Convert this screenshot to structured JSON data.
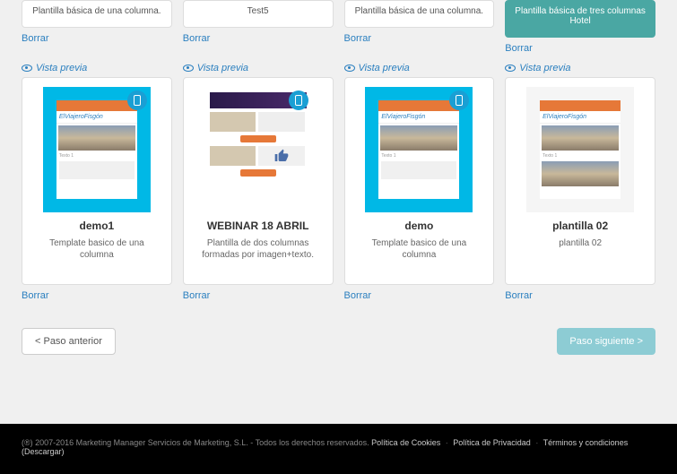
{
  "labels": {
    "delete": "Borrar",
    "preview": "Vista previa",
    "prev_button": "< Paso anterior",
    "next_button": "Paso siguiente >"
  },
  "top_row": [
    {
      "desc": "Plantilla básica de una columna.",
      "teal": false
    },
    {
      "desc": "Test5",
      "teal": false
    },
    {
      "desc": "Plantilla básica de una columna.",
      "teal": false
    },
    {
      "desc": "Plantilla básica de tres columnas Hotel",
      "teal": true
    }
  ],
  "templates": [
    {
      "title": "demo1",
      "desc": "Template basico de una columna",
      "thumb_type": "blue-phone",
      "logo_text": "ElViajeroFisgón"
    },
    {
      "title": "WEBINAR 18 ABRIL",
      "desc": "Plantilla de dos columnas formadas por imagen+texto.",
      "thumb_type": "webinar",
      "logo_text": ""
    },
    {
      "title": "demo",
      "desc": "Template basico de una columna",
      "thumb_type": "blue-phone",
      "logo_text": "ElViajeroFisgón"
    },
    {
      "title": "plantilla 02",
      "desc": "plantilla 02",
      "thumb_type": "light",
      "logo_text": "ElViajeroFisgón"
    }
  ],
  "footer": {
    "copyright": "(®) 2007-2016 Marketing Manager Servicios de Marketing, S.L. - Todos los derechos reservados.",
    "links": {
      "cookies": "Política de Cookies",
      "privacy": "Política de Privacidad",
      "terms": "Términos y condiciones (Descargar)"
    }
  }
}
